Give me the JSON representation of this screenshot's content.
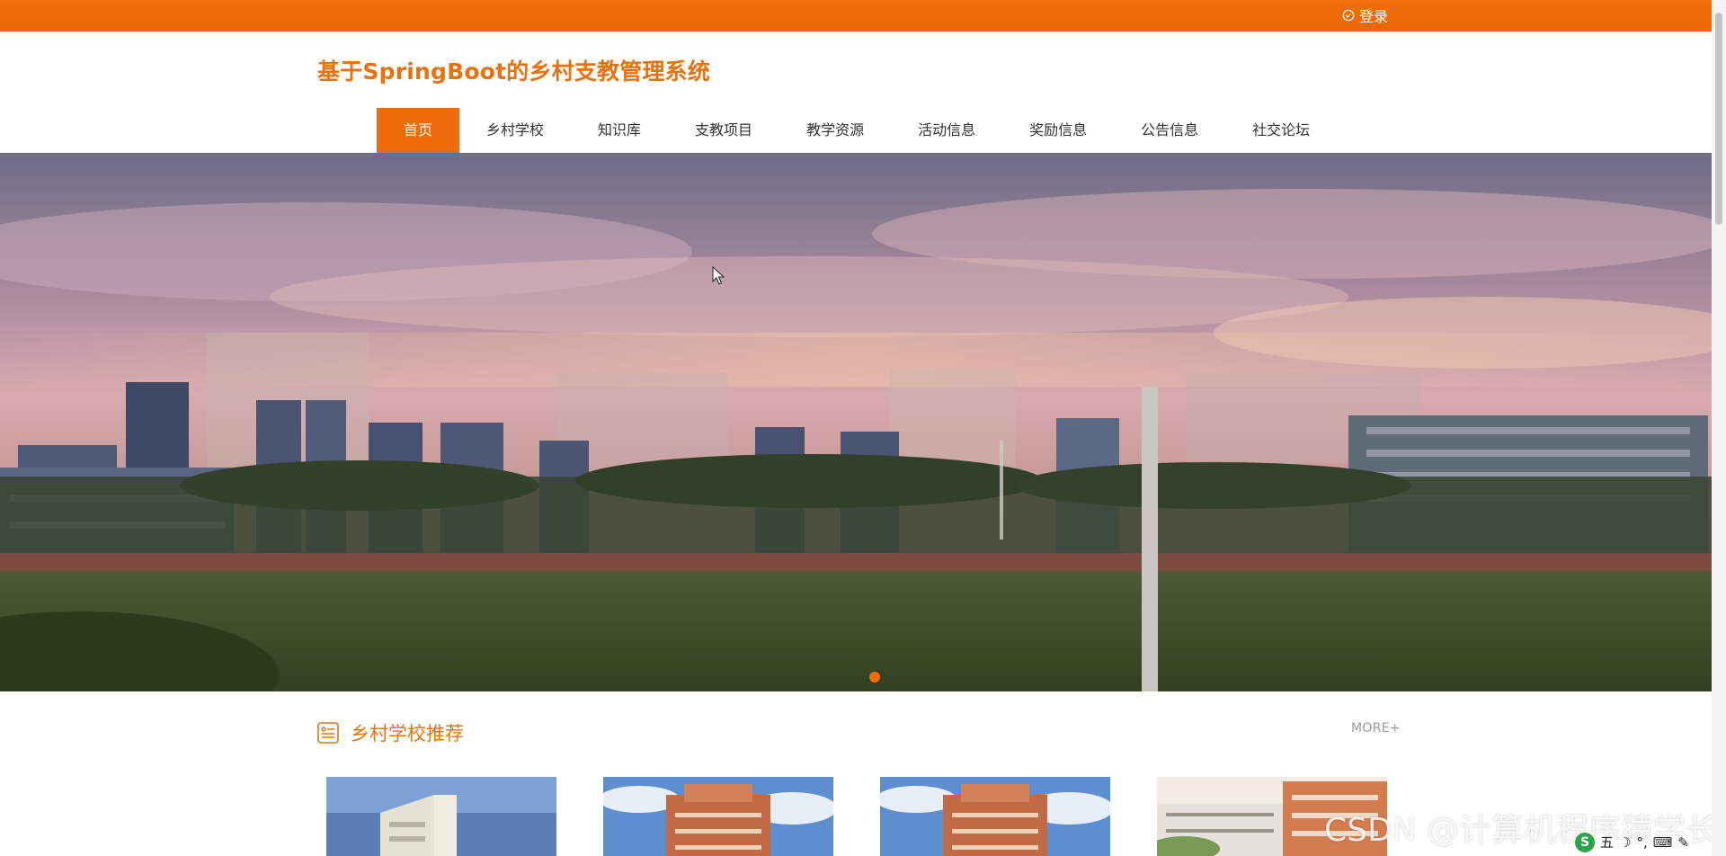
{
  "topbar": {
    "login_label": "登录",
    "login_icon": "check-circle-icon",
    "bg_color": "#ef6c0d"
  },
  "header": {
    "site_title": "基于SpringBoot的乡村支教管理系统",
    "title_color": "#e8720f"
  },
  "nav": {
    "items": [
      {
        "label": "首页",
        "active": true
      },
      {
        "label": "乡村学校",
        "active": false
      },
      {
        "label": "知识库",
        "active": false
      },
      {
        "label": "支教项目",
        "active": false
      },
      {
        "label": "教学资源",
        "active": false
      },
      {
        "label": "活动信息",
        "active": false
      },
      {
        "label": "奖励信息",
        "active": false
      },
      {
        "label": "公告信息",
        "active": false
      },
      {
        "label": "社交论坛",
        "active": false
      }
    ],
    "active_color": "#ef6c0d"
  },
  "hero": {
    "image": "school-campus-sunset-photo",
    "carousel_dots": 1,
    "active_dot": 1
  },
  "section": {
    "title": "乡村学校推荐",
    "icon": "list-box-icon",
    "more_label": "MORE+"
  },
  "cards": [
    {
      "image": "school-building-photo-1"
    },
    {
      "image": "school-building-photo-2"
    },
    {
      "image": "school-building-photo-3"
    },
    {
      "image": "school-building-photo-4"
    }
  ],
  "watermark": {
    "text": "CSDN @计算机程序猿学长"
  },
  "ime": {
    "label": "五"
  }
}
